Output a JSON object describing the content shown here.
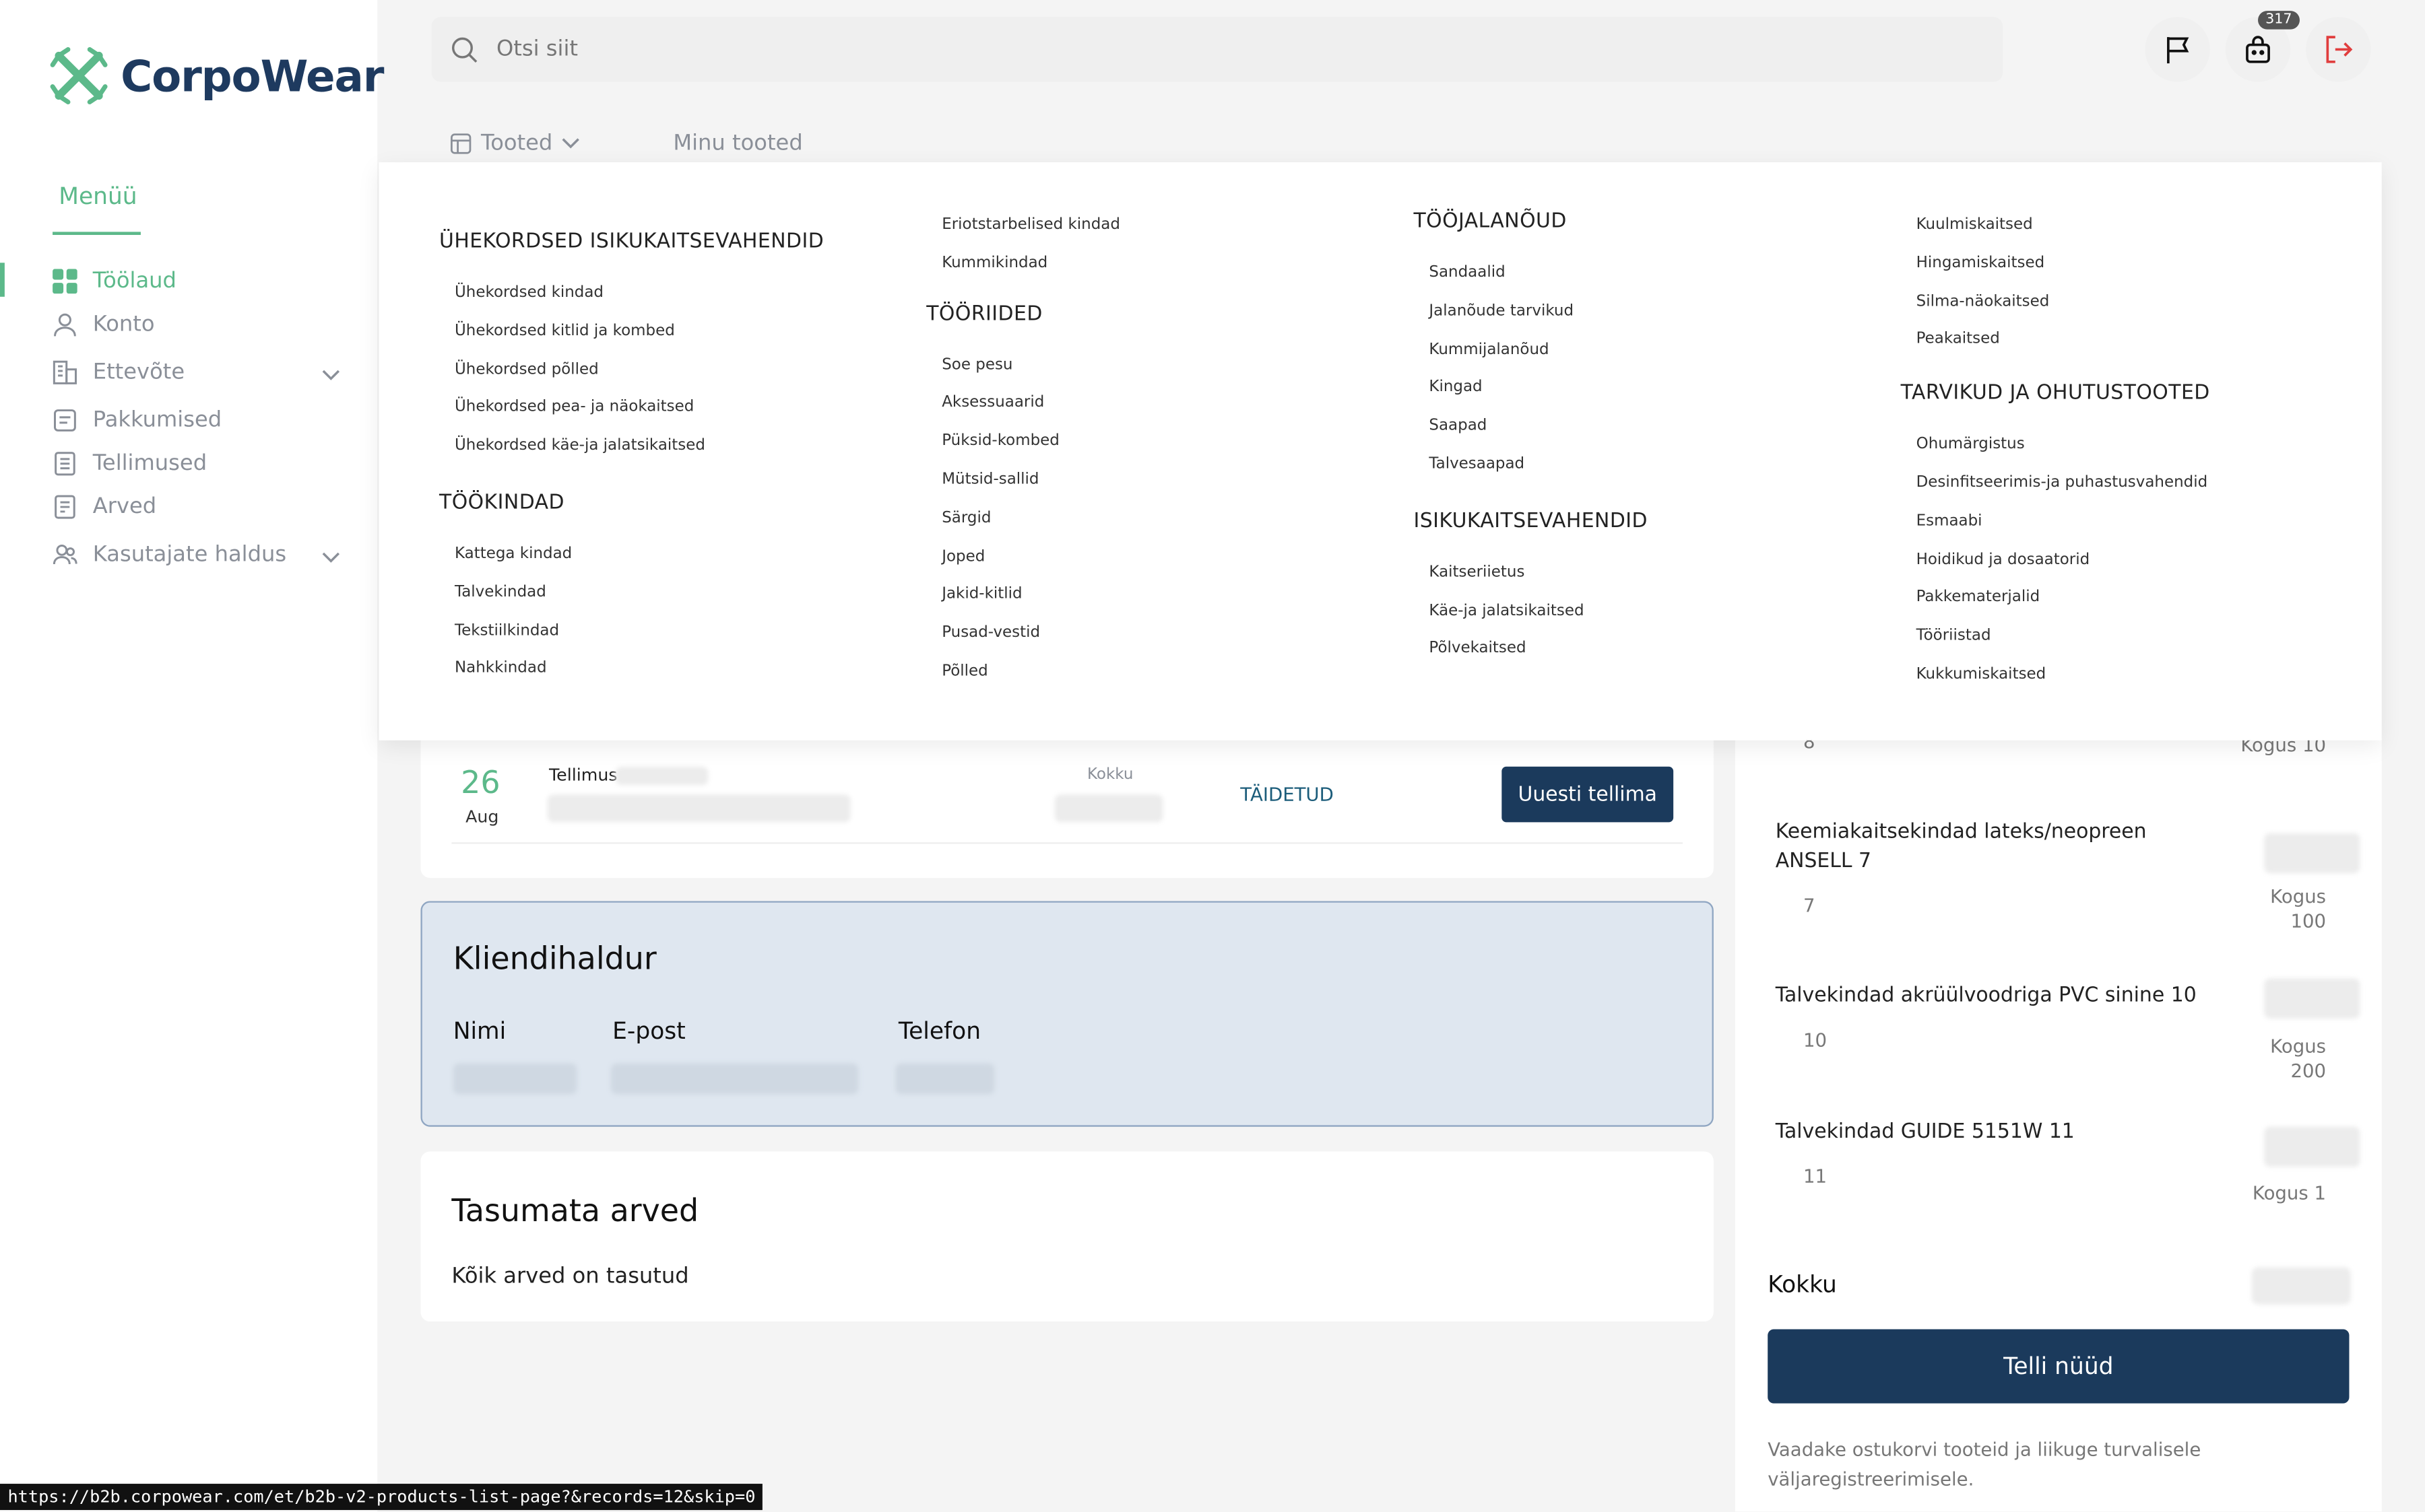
{
  "brand": {
    "name": "CorpoWear",
    "accent": "#5cb98a",
    "navy": "#1b3a5c"
  },
  "sidebar": {
    "menu_title": "Menüü",
    "items": [
      {
        "label": "Töölaud",
        "icon": "dashboard-icon"
      },
      {
        "label": "Konto",
        "icon": "user-icon"
      },
      {
        "label": "Ettevõte",
        "icon": "building-icon"
      },
      {
        "label": "Pakkumised",
        "icon": "document-icon"
      },
      {
        "label": "Tellimused",
        "icon": "list-icon"
      },
      {
        "label": "Arved",
        "icon": "invoice-icon"
      },
      {
        "label": "Kasutajate haldus",
        "icon": "users-icon"
      }
    ]
  },
  "header": {
    "search_placeholder": "Otsi siit",
    "cart_count": "317"
  },
  "tabs": {
    "products": "Tooted",
    "my_products": "Minu tooted"
  },
  "mega_menu": {
    "col1": {
      "cat1": "ÜHEKORDSED ISIKUKAITSEVAHENDID",
      "cat1_items": [
        "Ühekordsed kindad",
        "Ühekordsed kitlid ja kombed",
        "Ühekordsed põlled",
        "Ühekordsed pea- ja näokaitsed",
        "Ühekordsed käe-ja jalatsikaitsed"
      ],
      "cat2": "TÖÖKINDAD",
      "cat2_items": [
        "Kattega kindad",
        "Talvekindad",
        "Tekstiilkindad",
        "Nahkkindad"
      ]
    },
    "col2": {
      "pre_items": [
        "Eriotstarbelised kindad",
        "Kummikindad"
      ],
      "cat": "TÖÖRIIDED",
      "items": [
        "Soe pesu",
        "Aksessuaarid",
        "Püksid-kombed",
        "Mütsid-sallid",
        "Särgid",
        "Joped",
        "Jakid-kitlid",
        "Pusad-vestid",
        "Põlled"
      ]
    },
    "col3": {
      "cat1": "TÖÖJALANÕUD",
      "cat1_items": [
        "Sandaalid",
        "Jalanõude tarvikud",
        "Kummijalanõud",
        "Kingad",
        "Saapad",
        "Talvesaapad"
      ],
      "cat2": "ISIKUKAITSEVAHENDID",
      "cat2_items": [
        "Kaitseriietus",
        "Käe-ja jalatsikaitsed",
        "Põlvekaitsed"
      ]
    },
    "col4": {
      "pre_items": [
        "Kuulmiskaitsed",
        "Hingamiskaitsed",
        "Silma-näokaitsed",
        "Peakaitsed"
      ],
      "cat": "TARVIKUD JA OHUTUSTOOTED",
      "items": [
        "Ohumärgistus",
        "Desinfitseerimis-ja puhastusvahendid",
        "Esmaabi",
        "Hoidikud ja dosaatorid",
        "Pakkematerjalid",
        "Tööriistad",
        "Kukkumiskaitsed"
      ]
    }
  },
  "orders": {
    "day": "26",
    "month": "Aug",
    "label": "Tellimus",
    "total_label": "Kokku",
    "status": "TÄIDETUD",
    "reorder": "Uuesti tellima"
  },
  "manager": {
    "title": "Kliendihaldur",
    "name": "Nimi",
    "email": "E-post",
    "phone": "Telefon"
  },
  "invoices": {
    "title": "Tasumata arved",
    "message": "Kõik arved on tasutud"
  },
  "cart": {
    "top_partial": {
      "size": "8",
      "qty": "Kogus 10"
    },
    "items": [
      {
        "title": "Keemiakaitsekindad lateks/neopreen ANSELL 7",
        "size": "7",
        "qty1": "Kogus",
        "qty2": "100"
      },
      {
        "title": "Talvekindad akrüülvoodriga PVC sinine 10",
        "size": "10",
        "qty1": "Kogus",
        "qty2": "200"
      },
      {
        "title": "Talvekindad GUIDE 5151W 11",
        "size": "11",
        "qty1": "Kogus 1",
        "qty2": ""
      }
    ],
    "total_label": "Kokku",
    "order_button": "Telli nüüd",
    "note": "Vaadake ostukorvi tooteid ja liikuge turvalisele väljaregistreerimisele."
  },
  "status_url": "https://b2b.corpowear.com/et/b2b-v2-products-list-page?&records=12&skip=0"
}
